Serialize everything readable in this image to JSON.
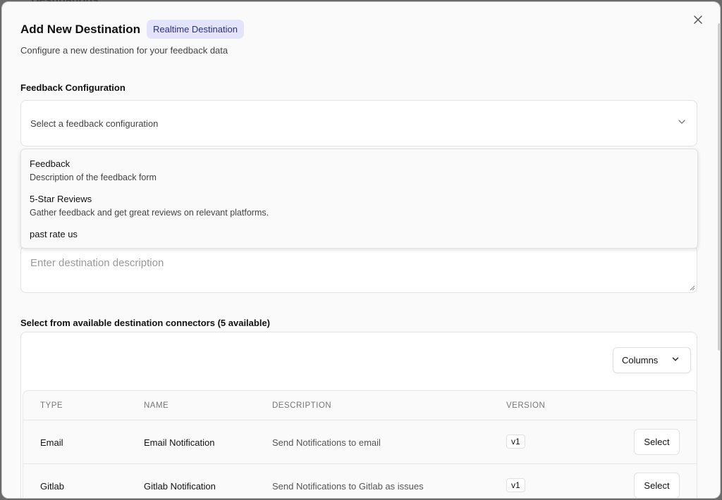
{
  "backdrop": {
    "page_heading": "Destinations"
  },
  "modal": {
    "title": "Add New Destination",
    "badge": "Realtime Destination",
    "subtitle": "Configure a new destination for your feedback data",
    "close_icon": "close-icon"
  },
  "feedback_config": {
    "label": "Feedback Configuration",
    "placeholder": "Select a feedback configuration",
    "options": [
      {
        "title": "Feedback",
        "description": "Description of the feedback form"
      },
      {
        "title": "5-Star Reviews",
        "description": "Gather feedback and get great reviews on relevant platforms."
      },
      {
        "title": "past rate us",
        "description": ""
      }
    ]
  },
  "description_field": {
    "placeholder": "Enter destination description"
  },
  "connectors": {
    "label": "Select from available destination connectors (5 available)",
    "columns_button": "Columns",
    "headers": {
      "type": "TYPE",
      "name": "NAME",
      "description": "DESCRIPTION",
      "version": "VERSION"
    },
    "rows": [
      {
        "type": "Email",
        "name": "Email Notification",
        "description": "Send Notifications to email",
        "version": "v1",
        "action": "Select"
      },
      {
        "type": "Gitlab",
        "name": "Gitlab Notification",
        "description": "Send Notifications to Gitlab as issues",
        "version": "v1",
        "action": "Select"
      }
    ]
  }
}
